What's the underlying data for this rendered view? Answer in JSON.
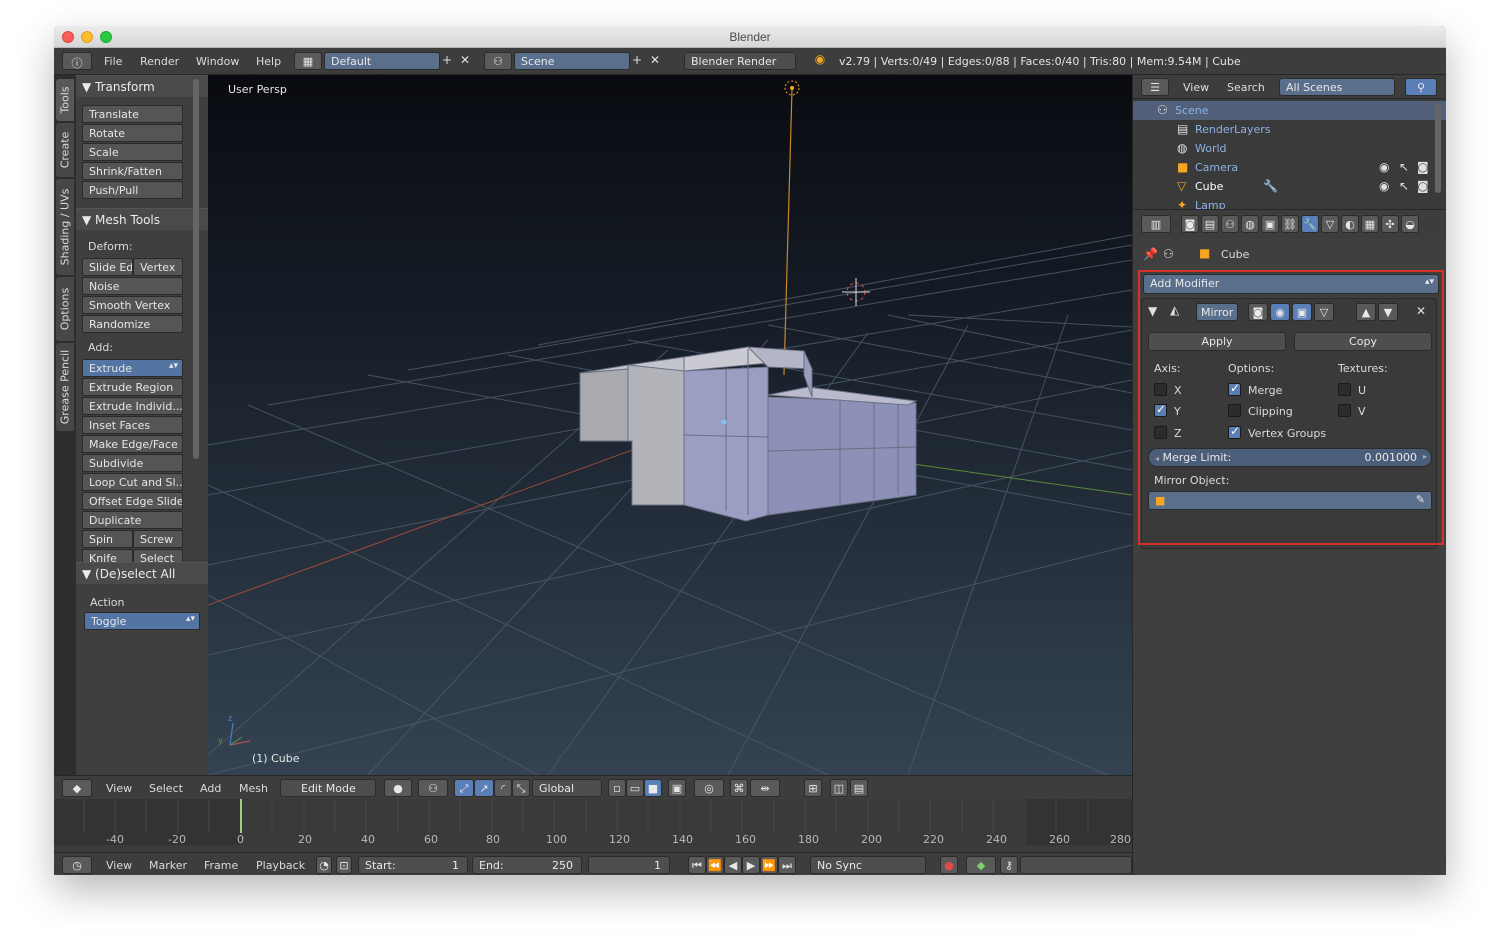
{
  "window": {
    "title": "Blender"
  },
  "infobar": {
    "menus": [
      "File",
      "Render",
      "Window",
      "Help"
    ],
    "layout": "Default",
    "scene": "Scene",
    "engine": "Blender Render",
    "stats": "v2.79 | Verts:0/49 | Edges:0/88 | Faces:0/40 | Tris:80 | Mem:9.54M | Cube"
  },
  "tabs": [
    "Tools",
    "Create",
    "Shading / UVs",
    "Options",
    "Grease Pencil"
  ],
  "tool_panel": {
    "transform": {
      "title": "Transform",
      "buttons": [
        "Translate",
        "Rotate",
        "Scale",
        "Shrink/Fatten",
        "Push/Pull"
      ]
    },
    "mesh_tools": {
      "title": "Mesh Tools",
      "deform_label": "Deform:",
      "slide_edge": "Slide Ed",
      "vertex": "Vertex",
      "deform_buttons": [
        "Noise",
        "Smooth Vertex",
        "Randomize"
      ],
      "add_label": "Add:",
      "extrude": "Extrude",
      "add_buttons": [
        "Extrude Region",
        "Extrude Individ...",
        "Inset Faces",
        "Make Edge/Face",
        "Subdivide",
        "Loop Cut and Sl...",
        "Offset Edge Slide",
        "Duplicate"
      ],
      "spin": "Spin",
      "screw": "Screw",
      "knife": "Knife",
      "select": "Select"
    },
    "deselect": {
      "title": "(De)select All",
      "action_label": "Action",
      "action_value": "Toggle"
    }
  },
  "viewport": {
    "view_name": "User Persp",
    "object_label": "(1) Cube"
  },
  "viewport_header": {
    "menus": [
      "View",
      "Select",
      "Add",
      "Mesh"
    ],
    "mode": "Edit Mode",
    "orientation": "Global"
  },
  "timeline": {
    "ticks": [
      "-40",
      "-20",
      "0",
      "20",
      "40",
      "60",
      "80",
      "100",
      "120",
      "140",
      "160",
      "180",
      "200",
      "220",
      "240",
      "260",
      "280"
    ],
    "menus": [
      "View",
      "Marker",
      "Frame",
      "Playback"
    ],
    "start_label": "Start:",
    "start": "1",
    "end_label": "End:",
    "end": "250",
    "current": "1",
    "sync": "No Sync"
  },
  "outliner": {
    "menus": [
      "View",
      "Search"
    ],
    "filter": "All Scenes",
    "items": [
      {
        "label": "Scene"
      },
      {
        "label": "RenderLayers"
      },
      {
        "label": "World"
      },
      {
        "label": "Camera"
      },
      {
        "label": "Cube"
      },
      {
        "label": "Lamp"
      }
    ]
  },
  "properties": {
    "breadcrumb": "Cube",
    "add_modifier": "Add Modifier",
    "modifier_name": "Mirror",
    "apply": "Apply",
    "copy": "Copy",
    "axis_label": "Axis:",
    "options_label": "Options:",
    "textures_label": "Textures:",
    "axes": [
      {
        "label": "X",
        "checked": false
      },
      {
        "label": "Y",
        "checked": true
      },
      {
        "label": "Z",
        "checked": false
      }
    ],
    "options": [
      {
        "label": "Merge",
        "checked": true
      },
      {
        "label": "Clipping",
        "checked": false
      },
      {
        "label": "Vertex Groups",
        "checked": true
      }
    ],
    "textures": [
      {
        "label": "U",
        "checked": false
      },
      {
        "label": "V",
        "checked": false
      }
    ],
    "merge_limit_label": "Merge Limit:",
    "merge_limit_value": "0.001000",
    "mirror_object_label": "Mirror Object:"
  },
  "colors": {
    "accent": "#5a7fb6",
    "highlight": "#d9302a",
    "selection": "#f5a623"
  }
}
